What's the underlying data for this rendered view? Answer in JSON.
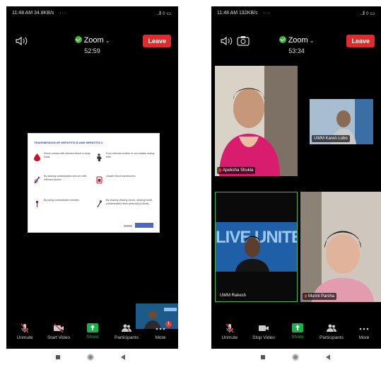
{
  "left_phone": {
    "status": {
      "time": "11:48 AM",
      "speed": "34.8KB/s",
      "dots": "···",
      "signal": "..‖ ◊ ▭"
    },
    "meeting": {
      "title": "Zoom",
      "timer": "52:59",
      "leave_label": "Leave"
    },
    "slide": {
      "title": "TRANSMISSION OF HEPATITIS B AND HEPATITIS C",
      "items": [
        {
          "icon": "blood-drop-icon",
          "text": "Direct contact with infected blood or body fluids"
        },
        {
          "icon": "pregnant-mother-icon",
          "text": "From infected mother to new babies during birth"
        },
        {
          "icon": "syringe-icon",
          "text": "By sharing contaminated and sex with infected person"
        },
        {
          "icon": "blood-bag-icon",
          "text": "Unsafe blood transfusions"
        },
        {
          "icon": "razor-icon",
          "text": "By using contaminated needles"
        },
        {
          "icon": "toothbrush-icon",
          "text": "By sharing shaving razors, sharing brush, contaminated other personal products"
        }
      ]
    },
    "toolbar": [
      {
        "name": "unmute-button",
        "icon": "mic-muted-icon",
        "label": "Unmute"
      },
      {
        "name": "start-video-button",
        "icon": "video-off-icon",
        "label": "Start Video"
      },
      {
        "name": "share-button",
        "icon": "share-screen-icon",
        "label": "Share"
      },
      {
        "name": "participants-button",
        "icon": "participants-icon",
        "label": "Participants"
      },
      {
        "name": "more-button",
        "icon": "more-icon",
        "label": "More"
      }
    ]
  },
  "right_phone": {
    "status": {
      "time": "11:48 AM",
      "speed": "132KB/s",
      "dots": "···",
      "signal": "..‖ ◊ ▭"
    },
    "meeting": {
      "title": "Zoom",
      "timer": "53:34",
      "leave_label": "Leave"
    },
    "tiles": {
      "apeksha": "Apeksha Shukla",
      "karen": "UWM Karen Lobo",
      "rakesh": "UWM Rakesh",
      "munni": "Munni Parsha",
      "banner_text": "LIVE UNITED"
    },
    "toolbar": [
      {
        "name": "unmute-button",
        "icon": "mic-muted-icon",
        "label": "Unmute"
      },
      {
        "name": "stop-video-button",
        "icon": "video-on-icon",
        "label": "Stop Video"
      },
      {
        "name": "share-button",
        "icon": "share-screen-icon",
        "label": "Share"
      },
      {
        "name": "participants-button",
        "icon": "participants-icon",
        "label": "Participants"
      },
      {
        "name": "more-button",
        "icon": "more-icon",
        "label": "More"
      }
    ]
  },
  "colors": {
    "leave": "#e02b2b",
    "share": "#17b34a",
    "active_speaker": "#4fb84f",
    "badge": "#e33333"
  },
  "more_badge": "1"
}
